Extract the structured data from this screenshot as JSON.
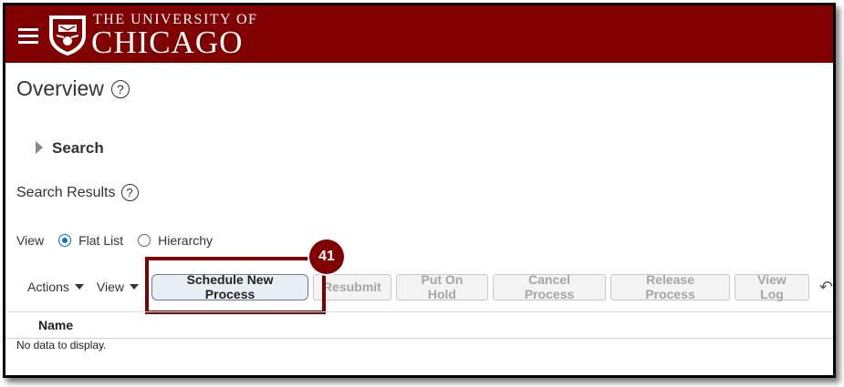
{
  "header": {
    "university_line": "THE UNIVERSITY OF",
    "university_name": "CHICAGO",
    "brand_color": "#800000",
    "icons": [
      "hamburger-menu-icon",
      "university-crest-icon"
    ]
  },
  "page": {
    "title": "Overview",
    "help_glyph": "?"
  },
  "search": {
    "label": "Search"
  },
  "results": {
    "title": "Search Results",
    "help_glyph": "?",
    "view_label": "View",
    "options": [
      "Flat List",
      "Hierarchy"
    ],
    "selected_option": "Flat List"
  },
  "toolbar": {
    "actions_label": "Actions",
    "view_label": "View",
    "schedule_label": "Schedule New Process",
    "resubmit_label": "Resubmit",
    "put_on_hold_label": "Put On Hold",
    "cancel_label": "Cancel Process",
    "release_label": "Release Process",
    "view_log_label": "View Log",
    "refresh_glyph": "↶"
  },
  "annotation": {
    "step_number": "41",
    "accent_color": "#800000"
  },
  "table": {
    "columns": [
      "Name"
    ],
    "empty_message": "No data to display."
  }
}
